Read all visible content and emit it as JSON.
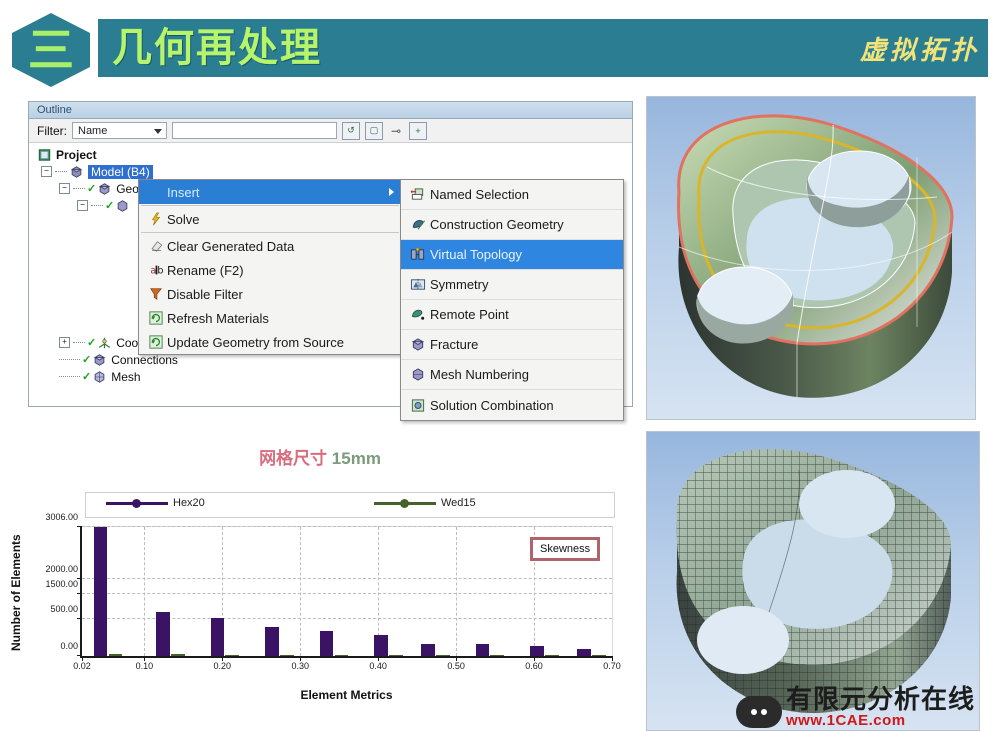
{
  "banner": {
    "number": "三",
    "title": "几何再处理",
    "subtitle": "虚拟拓扑"
  },
  "outline": {
    "panel_title": "Outline",
    "filter": {
      "label": "Filter:",
      "select_value": "Name",
      "input_value": "",
      "input_placeholder": "",
      "icons": [
        "refresh-icon",
        "eraser-icon",
        "probe-icon",
        "expand-all-icon"
      ]
    },
    "tree": [
      {
        "label": "Project",
        "icon": "project-icon",
        "depth": 0,
        "expander": "",
        "selected": false,
        "check": false
      },
      {
        "label": "Model (B4)",
        "icon": "model-icon",
        "depth": 1,
        "expander": "-",
        "selected": true,
        "check": false
      },
      {
        "label": "Geo",
        "icon": "geometry-icon",
        "depth": 2,
        "expander": "-",
        "selected": false,
        "check": true
      },
      {
        "label": "",
        "icon": "part-icon",
        "depth": 3,
        "expander": "-",
        "selected": false,
        "check": true
      },
      {
        "label": "Coordinate Systems",
        "icon": "coordinate-systems-icon",
        "depth": 2,
        "expander": "+",
        "selected": false,
        "check": true
      },
      {
        "label": "Connections",
        "icon": "connections-icon",
        "depth": 2,
        "expander": "",
        "selected": false,
        "check": true
      },
      {
        "label": "Mesh",
        "icon": "mesh-icon",
        "depth": 2,
        "expander": "",
        "selected": false,
        "check": true
      }
    ]
  },
  "context_menu": {
    "items": [
      {
        "label": "Insert",
        "icon": "",
        "active": true,
        "submenu": true
      },
      {
        "label": "Solve",
        "icon": "lightning-icon",
        "active": false,
        "submenu": false
      },
      {
        "label": "Clear Generated Data",
        "icon": "eraser-icon",
        "active": false,
        "submenu": false
      },
      {
        "label": "Rename (F2)",
        "icon": "rename-icon",
        "active": false,
        "submenu": false
      },
      {
        "label": "Disable Filter",
        "icon": "funnel-icon",
        "active": false,
        "submenu": false
      },
      {
        "label": "Refresh Materials",
        "icon": "refresh-icon",
        "active": false,
        "submenu": false
      },
      {
        "label": "Update Geometry from Source",
        "icon": "refresh-icon",
        "active": false,
        "submenu": false
      }
    ]
  },
  "insert_submenu": {
    "items": [
      {
        "label": "Named Selection",
        "icon": "named-selection-icon",
        "active": false
      },
      {
        "label": "Construction Geometry",
        "icon": "construction-geometry-icon",
        "active": false
      },
      {
        "label": "Virtual Topology",
        "icon": "virtual-topology-icon",
        "active": true
      },
      {
        "label": "Symmetry",
        "icon": "symmetry-icon",
        "active": false
      },
      {
        "label": "Remote Point",
        "icon": "remote-point-icon",
        "active": false
      },
      {
        "label": "Fracture",
        "icon": "fracture-icon",
        "active": false
      },
      {
        "label": "Mesh Numbering",
        "icon": "mesh-numbering-icon",
        "active": false
      },
      {
        "label": "Solution Combination",
        "icon": "solution-combination-icon",
        "active": false
      }
    ]
  },
  "background_watermark": "1CAE.COM",
  "chart_data": {
    "type": "bar",
    "title_cn": "网格尺寸",
    "title_value": "15mm",
    "xlabel": "Element Metrics",
    "ylabel": "Number of Elements",
    "annotation": "Skewness",
    "xlim": [
      0.02,
      0.7
    ],
    "xticks": [
      "0.02",
      "0.10",
      "0.20",
      "0.30",
      "0.40",
      "0.50",
      "0.60",
      "0.70"
    ],
    "xtick_values": [
      0.02,
      0.1,
      0.2,
      0.3,
      0.4,
      0.5,
      0.6,
      0.7
    ],
    "yticks": [
      "0.00",
      "500.00",
      "1500.00",
      "2000.00",
      "3006.00"
    ],
    "ytick_values": [
      0,
      500,
      1500,
      2000,
      3006
    ],
    "ytick_positions": [
      0,
      29,
      48,
      60,
      100
    ],
    "legend": [
      {
        "name": "Hex20",
        "color": "#3b1364"
      },
      {
        "name": "Wed15",
        "color": "#47612b"
      }
    ],
    "categories": [
      0.035,
      0.115,
      0.185,
      0.255,
      0.325,
      0.395,
      0.455,
      0.525,
      0.595,
      0.655
    ],
    "series": [
      {
        "name": "Hex20",
        "color": "#3b1364",
        "values": [
          3006,
          750,
          510,
          390,
          330,
          280,
          160,
          165,
          130,
          95
        ]
      },
      {
        "name": "Wed15",
        "color": "#47612b",
        "values": [
          22,
          25,
          12,
          18,
          20,
          10,
          12,
          14,
          10,
          8
        ]
      }
    ],
    "grid": true,
    "legend_position": "top"
  },
  "images": {
    "top": {
      "name": "virtual-topology-geometry-view",
      "caption": ""
    },
    "bottom": {
      "name": "hex-mesh-view",
      "caption": ""
    }
  },
  "watermark": {
    "brand_cn": "有限元分析在线",
    "url": "www.1CAE.com"
  }
}
